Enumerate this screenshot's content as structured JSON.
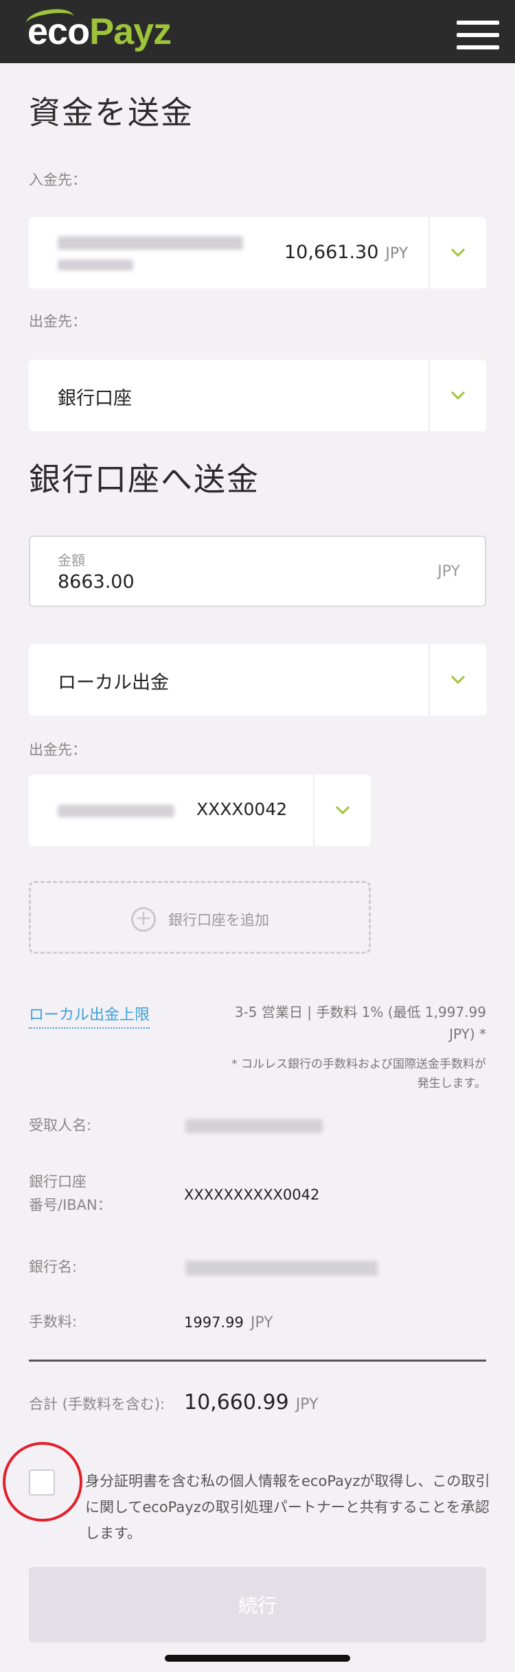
{
  "brand": {
    "logo_eco": "eco",
    "logo_payz": "Payz",
    "accent": "#9dc43a",
    "header_bg": "#2b2b2b"
  },
  "header": {
    "menu_icon": "hamburger-menu-icon"
  },
  "send": {
    "title": "資金を送金",
    "from_label": "入金先：",
    "from_amount": "10,661.30",
    "from_currency": "JPY",
    "to_label": "出金先：",
    "to_value": "銀行口座"
  },
  "bank": {
    "title": "銀行口座へ送金",
    "amount_label": "金額",
    "amount_value": "8663.00",
    "amount_currency": "JPY",
    "method": "ローカル出金",
    "dest_label": "出金先：",
    "dest_account": "XXXX0042",
    "add_account": "銀行口座を追加"
  },
  "limits": {
    "link": "ローカル出金上限",
    "fee_line1": "3-5 営業日 | 手数料 1% (最低 1,997.99",
    "fee_line2": "JPY) *",
    "note_line1": "* コルレス銀行の手数料および国際送金手数料が",
    "note_line2": "発生します。"
  },
  "summary": {
    "recipient_label": "受取人名:",
    "account_label_1": "銀行口座",
    "account_label_2": "番号/IBAN：",
    "account_value": "XXXXXXXXXX0042",
    "bank_label": "銀行名:",
    "fee_label": "手数料:",
    "fee_value": "1997.99",
    "fee_currency": "JPY",
    "total_label": "合計 (手数料を含む):",
    "total_value": "10,660.99",
    "total_currency": "JPY"
  },
  "consent": {
    "text": "身分証明書を含む私の個人情報をecoPayzが取得し、この取引に関してecoPayzの取引処理パートナーと共有することを承認します。"
  },
  "continue_button": "続行"
}
